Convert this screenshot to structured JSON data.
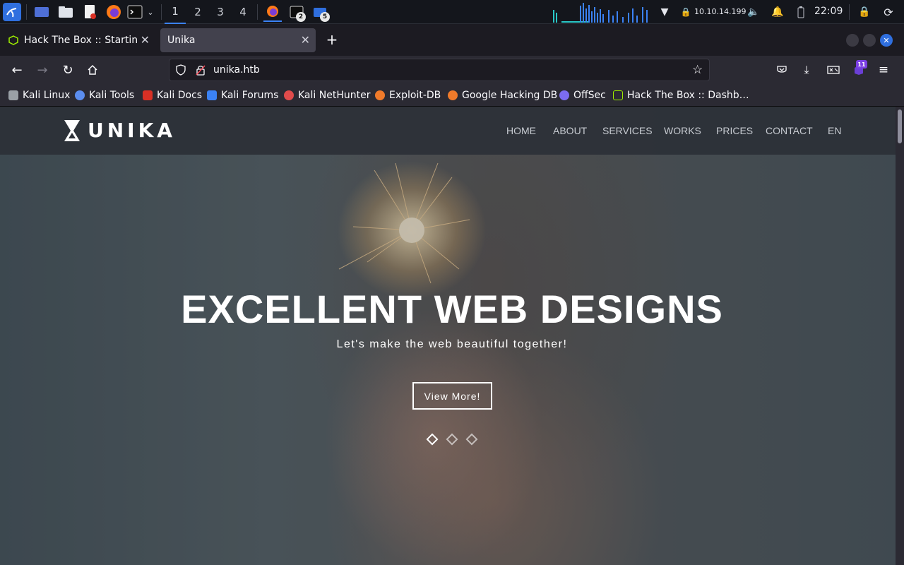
{
  "taskbar": {
    "workspaces": [
      "1",
      "2",
      "3",
      "4"
    ],
    "active_workspace": "1",
    "terminal_badge": "2",
    "folder_badge": "5",
    "ip_address": "10.10.14.199",
    "clock": "22:09"
  },
  "browser": {
    "tabs": [
      {
        "title": "Hack The Box :: Starting P",
        "active": false
      },
      {
        "title": "Unika",
        "active": true
      }
    ],
    "new_tab_label": "+",
    "url": "unika.htb",
    "extension_badge": "11",
    "bookmarks": [
      {
        "label": "Kali Linux",
        "color": "#9aa0a6"
      },
      {
        "label": "Kali Tools",
        "color": "#5b8def"
      },
      {
        "label": "Kali Docs",
        "color": "#d93025"
      },
      {
        "label": "Kali Forums",
        "color": "#3b82f6"
      },
      {
        "label": "Kali NetHunter",
        "color": "#e04b4b"
      },
      {
        "label": "Exploit-DB",
        "color": "#f07a2a"
      },
      {
        "label": "Google Hacking DB",
        "color": "#f07a2a"
      },
      {
        "label": "OffSec",
        "color": "#7c6cf0"
      },
      {
        "label": "Hack The Box :: Dashb…",
        "color": "#9fef00"
      }
    ]
  },
  "site": {
    "logo_text": "UNIKA",
    "menu": [
      "HOME",
      "ABOUT",
      "SERVICES",
      "WORKS",
      "PRICES",
      "CONTACT",
      "EN"
    ],
    "hero_title": "EXCELLENT WEB DESIGNS",
    "hero_subtitle": "Let's make the web beautiful together!",
    "cta_label": "View More!",
    "slides": 3,
    "active_slide": 1
  },
  "colors": {
    "accent": "#3b82f6",
    "header_bg": "#2d3138",
    "tab_active": "#42414d",
    "toolbar": "#2b2a33"
  }
}
